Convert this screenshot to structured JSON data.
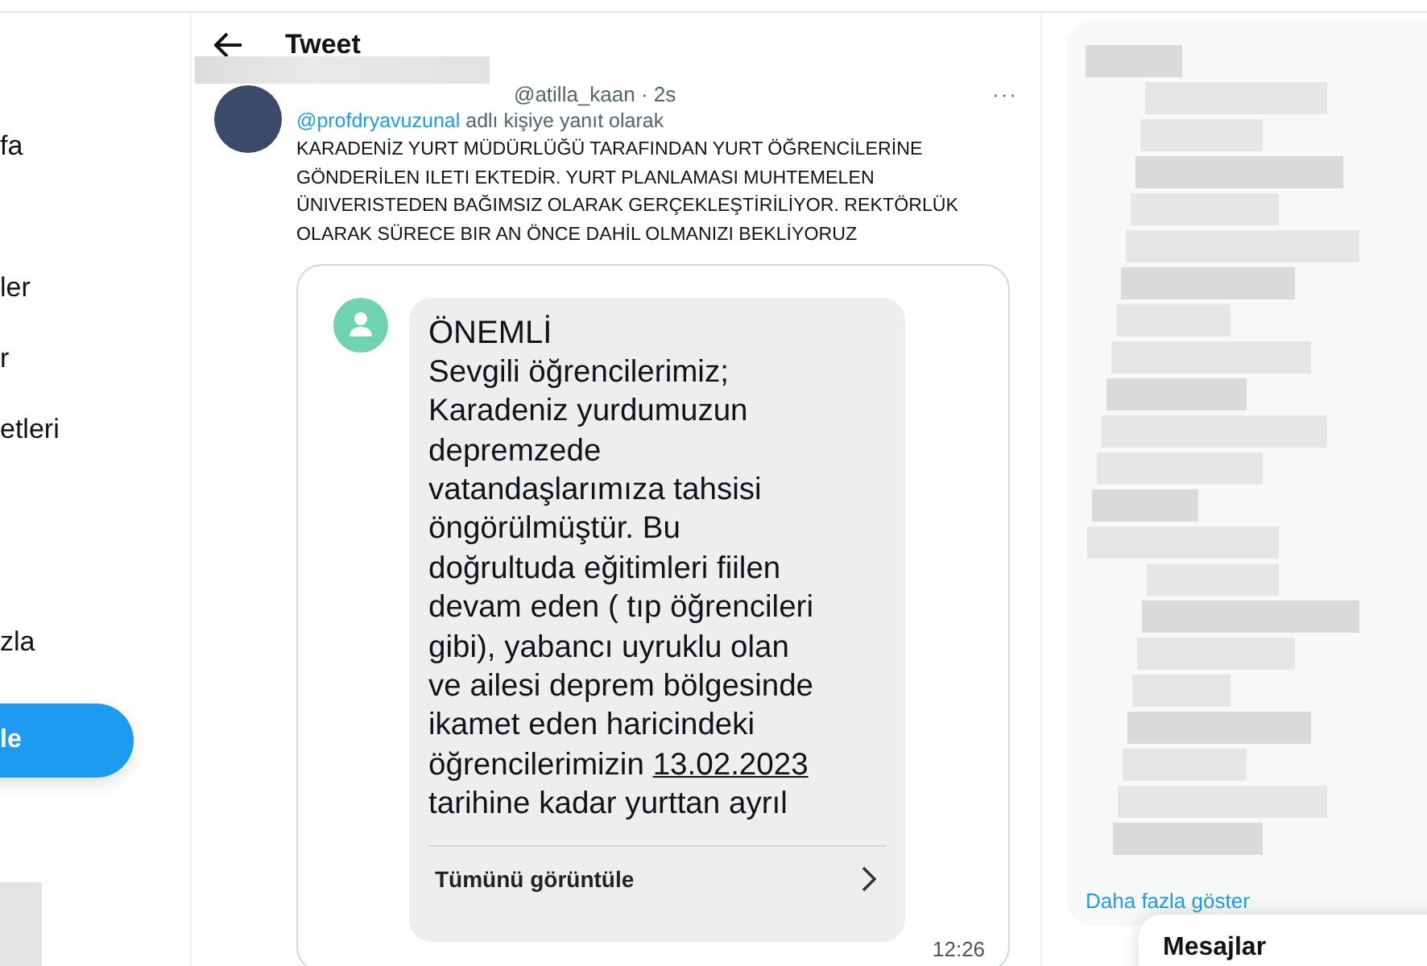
{
  "nav": {
    "items": [
      {
        "label": "fa"
      },
      {
        "label": "ler"
      },
      {
        "label": "r"
      },
      {
        "label": "etleri"
      },
      {
        "label": "zla"
      }
    ],
    "post_button": "le"
  },
  "header": {
    "title": "Tweet"
  },
  "tweet": {
    "handle_time": "@atilla_kaan · 2s",
    "more": "···",
    "reply_to": "@profdryavuzunal",
    "reply_suffix": "adlı kişiye yanıt olarak",
    "text": "KARADENİZ YURT MÜDÜRLÜĞÜ TARAFINDAN YURT ÖĞRENCİLERİNE\nGÖNDERİLEN ILETI EKTEDİR. YURT PLANLAMASI MUHTEMELEN\nÜNIVERISTEDEN BAĞIMSIZ OLARAK GERÇEKLEŞTİRİLİYOR. REKTÖRLÜK\nOLARAK SÜRECE BIR AN ÖNCE DAHİL OLMANIZI BEKLİYORUZ"
  },
  "sms": {
    "title": "ÖNEMLİ",
    "body": "Sevgili öğrencilerimiz;\nKaradeniz yurdumuzun\ndepremzede\nvatandaşlarımıza tahsisi\nöngörülmüştür. Bu\ndoğrultuda eğitimleri fiilen\ndevam eden ( tıp öğrencileri\ngibi), yabancı uyruklu olan\nve ailesi deprem bölgesinde\nikamet eden haricindeki\nöğrencilerimizin ",
    "date": "13.02.2023",
    "body_end": "\ntarihine kadar yurttan ayrıl",
    "view_all": "Tümünü görüntüle",
    "time": "12:26"
  },
  "sidebar": {
    "show_more": "Daha fazla göster"
  },
  "messages_drawer": {
    "title": "Mesajlar"
  }
}
